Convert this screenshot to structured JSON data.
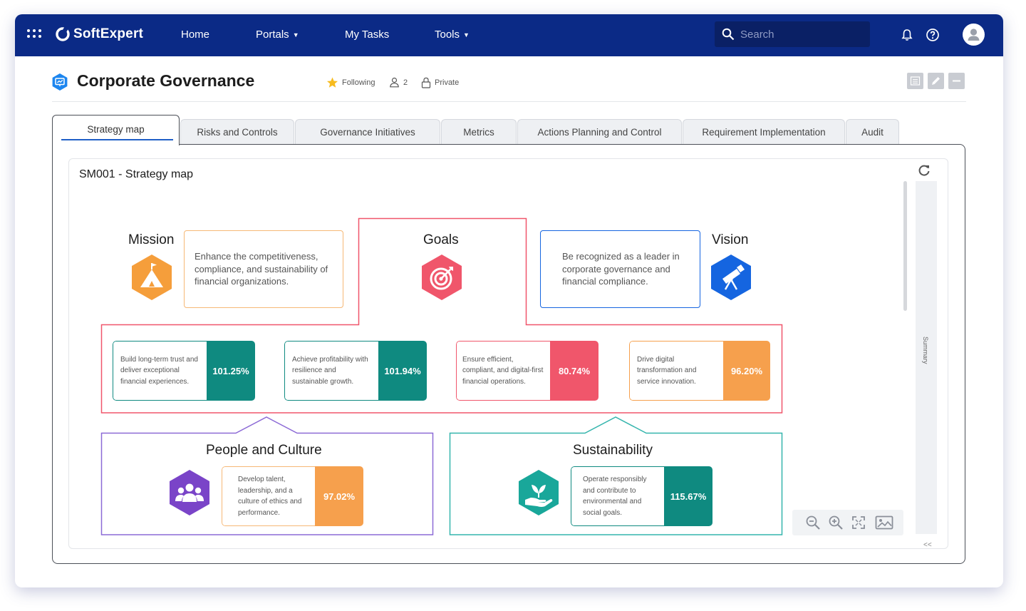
{
  "topbar": {
    "brand": "SoftExpert",
    "nav": [
      {
        "label": "Home",
        "has_menu": false
      },
      {
        "label": "Portals",
        "has_menu": true
      },
      {
        "label": "My Tasks",
        "has_menu": false
      },
      {
        "label": "Tools",
        "has_menu": true
      }
    ],
    "search_placeholder": "Search",
    "color": "#0b2a86"
  },
  "header": {
    "title": "Corporate Governance",
    "following": "Following",
    "members_count": "2",
    "privacy": "Private"
  },
  "tabs": [
    {
      "label": "Strategy map",
      "active": true
    },
    {
      "label": "Risks and Controls",
      "active": false
    },
    {
      "label": "Governance Initiatives",
      "active": false
    },
    {
      "label": "Metrics",
      "active": false
    },
    {
      "label": "Actions Planning and Control",
      "active": false
    },
    {
      "label": "Requirement Implementation",
      "active": false
    },
    {
      "label": "Audit",
      "active": false
    }
  ],
  "panel": {
    "title": "SM001 - Strategy map",
    "summary_label": "Summary",
    "collapse_glyph": "<<"
  },
  "map": {
    "mission": {
      "title": "Mission",
      "text": "Enhance the competitiveness, compliance, and sustainability of financial organizations.",
      "icon": "mountain-flag-icon",
      "color": "#f59e3b"
    },
    "goals": {
      "title": "Goals",
      "icon": "target-icon",
      "color": "#f0566b"
    },
    "vision": {
      "title": "Vision",
      "text": "Be recognized as a leader in corporate governance and financial compliance.",
      "icon": "telescope-icon",
      "color": "#1565e0"
    },
    "goal_cards": [
      {
        "text": "Build long-term trust and deliver exceptional financial experiences.",
        "value": "101.25%",
        "color": "#0f8a80"
      },
      {
        "text": "Achieve profitability with resilience and sustainable growth.",
        "value": "101.94%",
        "color": "#0f8a80"
      },
      {
        "text": "Ensure efficient, compliant, and digital-first financial operations.",
        "value": "80.74%",
        "color": "#f0566b"
      },
      {
        "text": "Drive digital transformation and service innovation.",
        "value": "96.20%",
        "color": "#f6a04d"
      }
    ],
    "people": {
      "title": "People and Culture",
      "icon": "people-group-icon",
      "icon_color": "#7a44c8",
      "card": {
        "text": "Develop talent, leadership, and a culture of ethics and performance.",
        "value": "97.02%",
        "color": "#f6a04d"
      }
    },
    "sustainability": {
      "title": "Sustainability",
      "icon": "hand-plant-icon",
      "icon_color": "#19a79a",
      "card": {
        "text": "Operate responsibly and contribute to environmental and social goals.",
        "value": "115.67%",
        "color": "#0f8a80"
      }
    }
  }
}
